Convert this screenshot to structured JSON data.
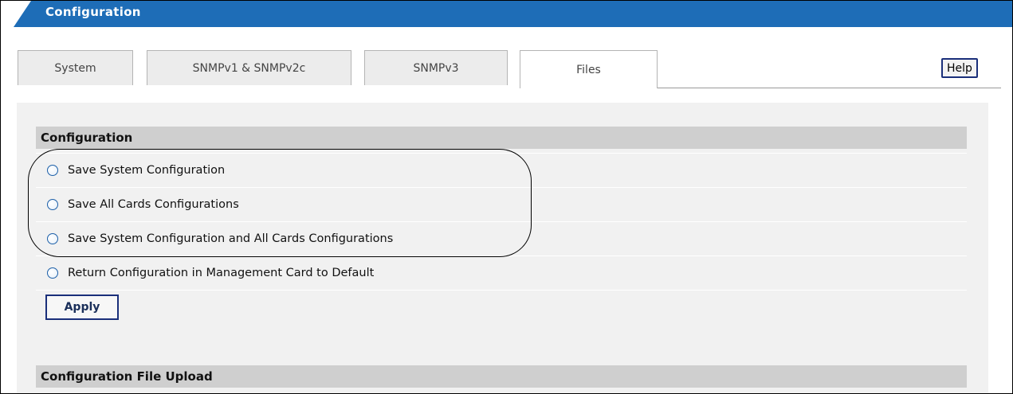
{
  "header": {
    "title": "Configuration"
  },
  "tabs": [
    {
      "label": "System",
      "active": false
    },
    {
      "label": "SNMPv1 & SNMPv2c",
      "active": false
    },
    {
      "label": "SNMPv3",
      "active": false
    },
    {
      "label": "Files",
      "active": true
    }
  ],
  "help_label": "Help",
  "configuration_section": {
    "title": "Configuration",
    "options": [
      {
        "label": "Save System Configuration",
        "selected": false
      },
      {
        "label": "Save All Cards Configurations",
        "selected": false
      },
      {
        "label": "Save System Configuration and All Cards Configurations",
        "selected": false
      },
      {
        "label": "Return Configuration in Management Card to Default",
        "selected": false
      }
    ],
    "apply_label": "Apply"
  },
  "upload_section": {
    "title": "Configuration File Upload"
  },
  "colors": {
    "title_bar": "#1e6db7",
    "section_header": "#cfcfcf",
    "panel": "#f1f1f1",
    "button_border": "#1a2f7a"
  }
}
